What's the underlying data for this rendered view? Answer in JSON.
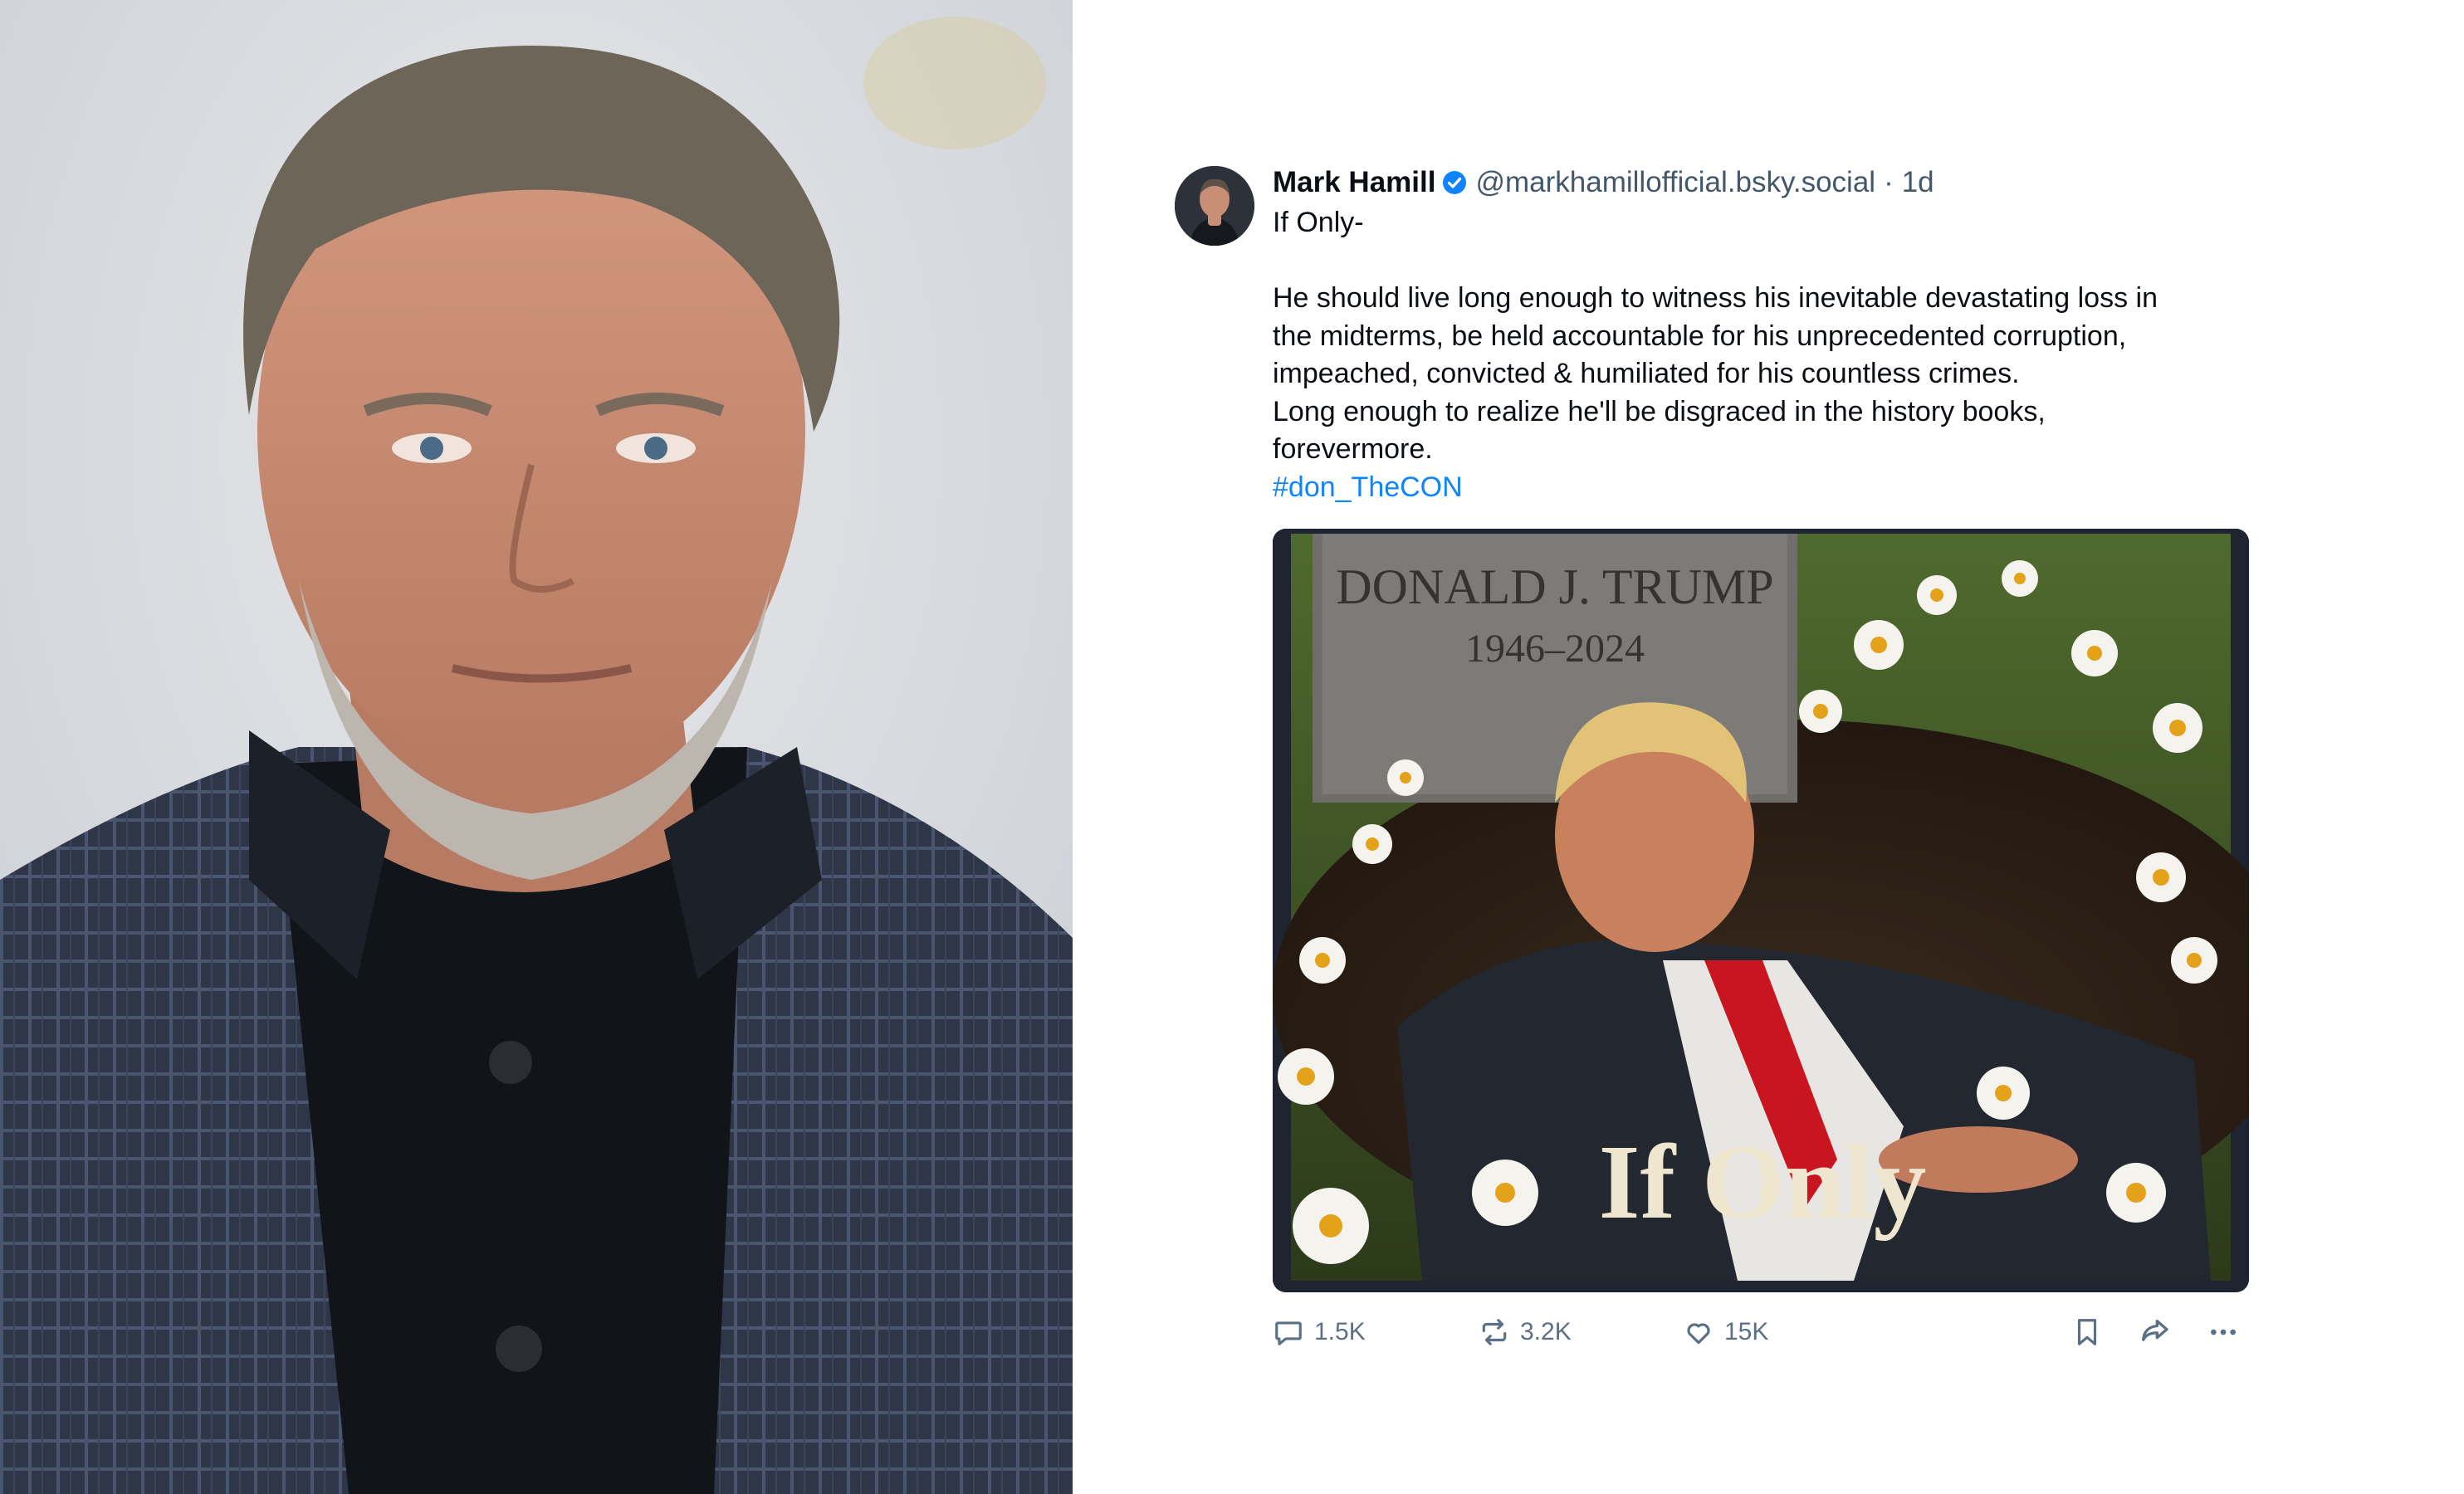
{
  "post": {
    "author": {
      "display_name": "Mark Hamill",
      "handle": "@markhamillofficial.bsky.social",
      "separator": "·",
      "time": "1d",
      "verified": true
    },
    "text_lines": [
      "If Only-",
      "",
      "He should live long enough to witness his inevitable devastating loss in",
      "the midterms, be held accountable for his unprecedented corruption,",
      "impeached, convicted & humiliated for his countless crimes.",
      "Long enough to realize he'll be disgraced in the history books,",
      "forevermore."
    ],
    "hashtag": "#don_TheCON",
    "image": {
      "headstone_name": "DONALD J. TRUMP",
      "headstone_years": "1946–2024",
      "caption": "If Only"
    },
    "stats": {
      "replies": "1.5K",
      "reposts": "3.2K",
      "likes": "15K"
    },
    "icons": [
      "reply-icon",
      "repost-icon",
      "like-icon",
      "bookmark-icon",
      "share-icon",
      "more-icon"
    ]
  },
  "colors": {
    "link": "#1083fe",
    "muted": "#42576c",
    "action": "#5b7085",
    "text": "#0b0f14"
  }
}
